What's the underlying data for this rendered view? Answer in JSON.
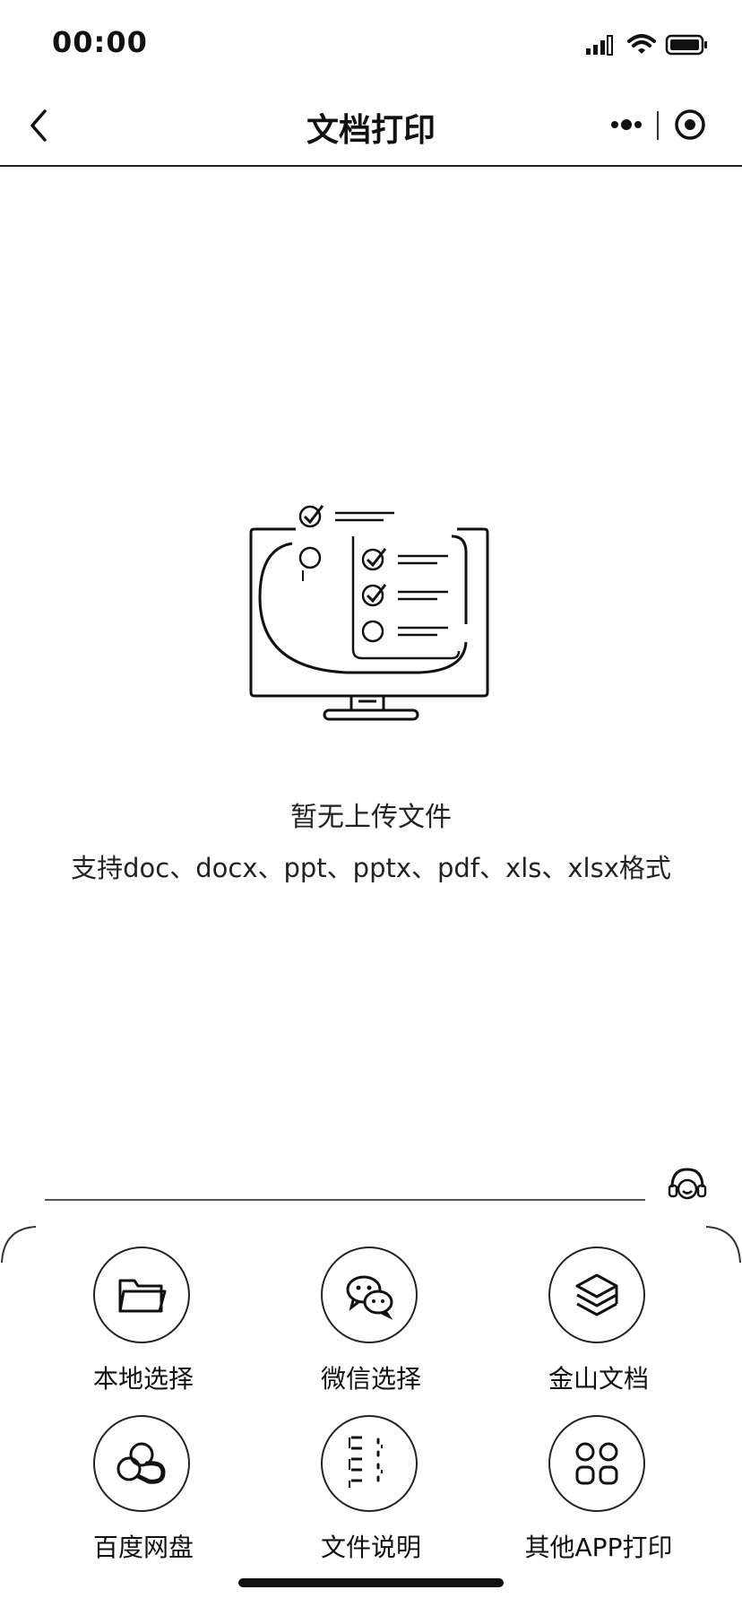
{
  "status_bar": {
    "time": "00:00",
    "icons": [
      "signal-icon",
      "wifi-icon",
      "battery-icon"
    ]
  },
  "nav": {
    "title": "文档打印",
    "back_icon": "chevron-left-icon",
    "more_icon": "more-dots-icon",
    "close_icon": "capsule-close-icon"
  },
  "empty_state": {
    "illustration": "monitor-checklist-illustration",
    "title": "暂无上传文件",
    "hint": "支持doc、docx、ppt、pptx、pdf、xls、xlsx格式"
  },
  "support": {
    "icon": "customer-service-icon"
  },
  "sources": [
    {
      "label": "本地选择",
      "icon": "folder-icon"
    },
    {
      "label": "微信选择",
      "icon": "wechat-icon"
    },
    {
      "label": "金山文档",
      "icon": "kingsoft-docs-icon"
    },
    {
      "label": "百度网盘",
      "icon": "baidu-netdisk-icon"
    },
    {
      "label": "文件说明",
      "icon": "file-guide-icon"
    },
    {
      "label": "其他APP打印",
      "icon": "apps-grid-icon"
    }
  ]
}
